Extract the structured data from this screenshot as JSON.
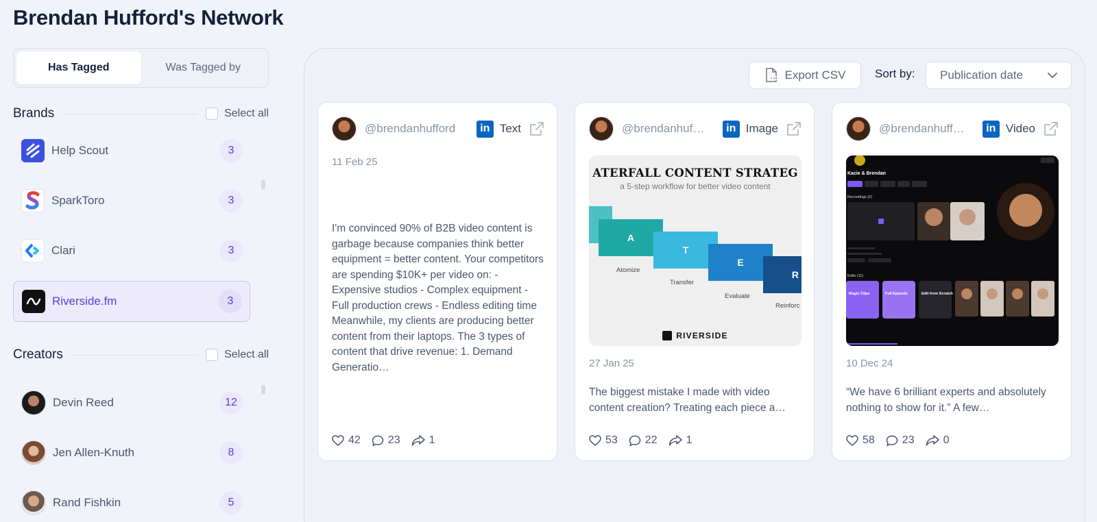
{
  "page": {
    "title": "Brendan Hufford's Network"
  },
  "tabs": [
    {
      "label": "Has Tagged",
      "active": true
    },
    {
      "label": "Was Tagged by",
      "active": false
    }
  ],
  "brands": {
    "title": "Brands",
    "select_all": "Select all",
    "items": [
      {
        "name": "Help Scout",
        "count": "3",
        "icon": "help-scout-logo"
      },
      {
        "name": "SparkToro",
        "count": "3",
        "icon": "sparktoro-logo"
      },
      {
        "name": "Clari",
        "count": "3",
        "icon": "clari-logo"
      },
      {
        "name": "Riverside.fm",
        "count": "3",
        "icon": "riverside-logo",
        "selected": true
      }
    ]
  },
  "creators": {
    "title": "Creators",
    "select_all": "Select all",
    "items": [
      {
        "name": "Devin Reed",
        "count": "12"
      },
      {
        "name": "Jen Allen-Knuth",
        "count": "8"
      },
      {
        "name": "Rand Fishkin",
        "count": "5"
      }
    ]
  },
  "toolbar": {
    "export_label": "Export CSV",
    "sort_label": "Sort by:",
    "sort_value": "Publication date"
  },
  "cards": [
    {
      "handle": "@brendanhufford",
      "platform": "in",
      "type": "Text",
      "date": "11 Feb 25",
      "text": "I'm convinced 90% of B2B video content is garbage because companies think better equipment = better content. Your competitors are spending $10K+ per video on: - Expensive studios - Complex equipment - Full production crews - Endless editing time Meanwhile, my clients are producing better content from their laptops. The 3 types of content that drive revenue: 1. Demand Generatio…",
      "likes": "42",
      "comments": "23",
      "shares": "1"
    },
    {
      "handle": "@brendanhuf…",
      "platform": "in",
      "type": "Image",
      "date": "27 Jan 25",
      "text": "The biggest mistake I made with video content creation? Treating each piece a…",
      "likes": "53",
      "comments": "22",
      "shares": "1",
      "image": {
        "title": "ATERFALL CONTENT STRATEG",
        "subtitle": "a 5-step workflow for better video content",
        "steps": [
          "A",
          "T",
          "E",
          "R"
        ],
        "captions": [
          "Atomize",
          "Transfer",
          "Evaluate",
          "Reinforc"
        ],
        "brand": "RIVERSIDE"
      }
    },
    {
      "handle": "@brendanhuff…",
      "platform": "in",
      "type": "Video",
      "date": "10 Dec 24",
      "text": "“We have 6 brilliant experts and absolutely nothing to show for it.” A few…",
      "likes": "58",
      "comments": "23",
      "shares": "0",
      "image": {
        "heading": "Kacie & Brendan",
        "recordings": "Recordings (2)",
        "edits": "Edits (11)",
        "tiles": [
          "Magic Clips",
          "Full Episode",
          "Edit from Scratch"
        ]
      }
    }
  ],
  "colors": {
    "accent": "#5a3ed6",
    "linkedin": "#0a66c2"
  }
}
